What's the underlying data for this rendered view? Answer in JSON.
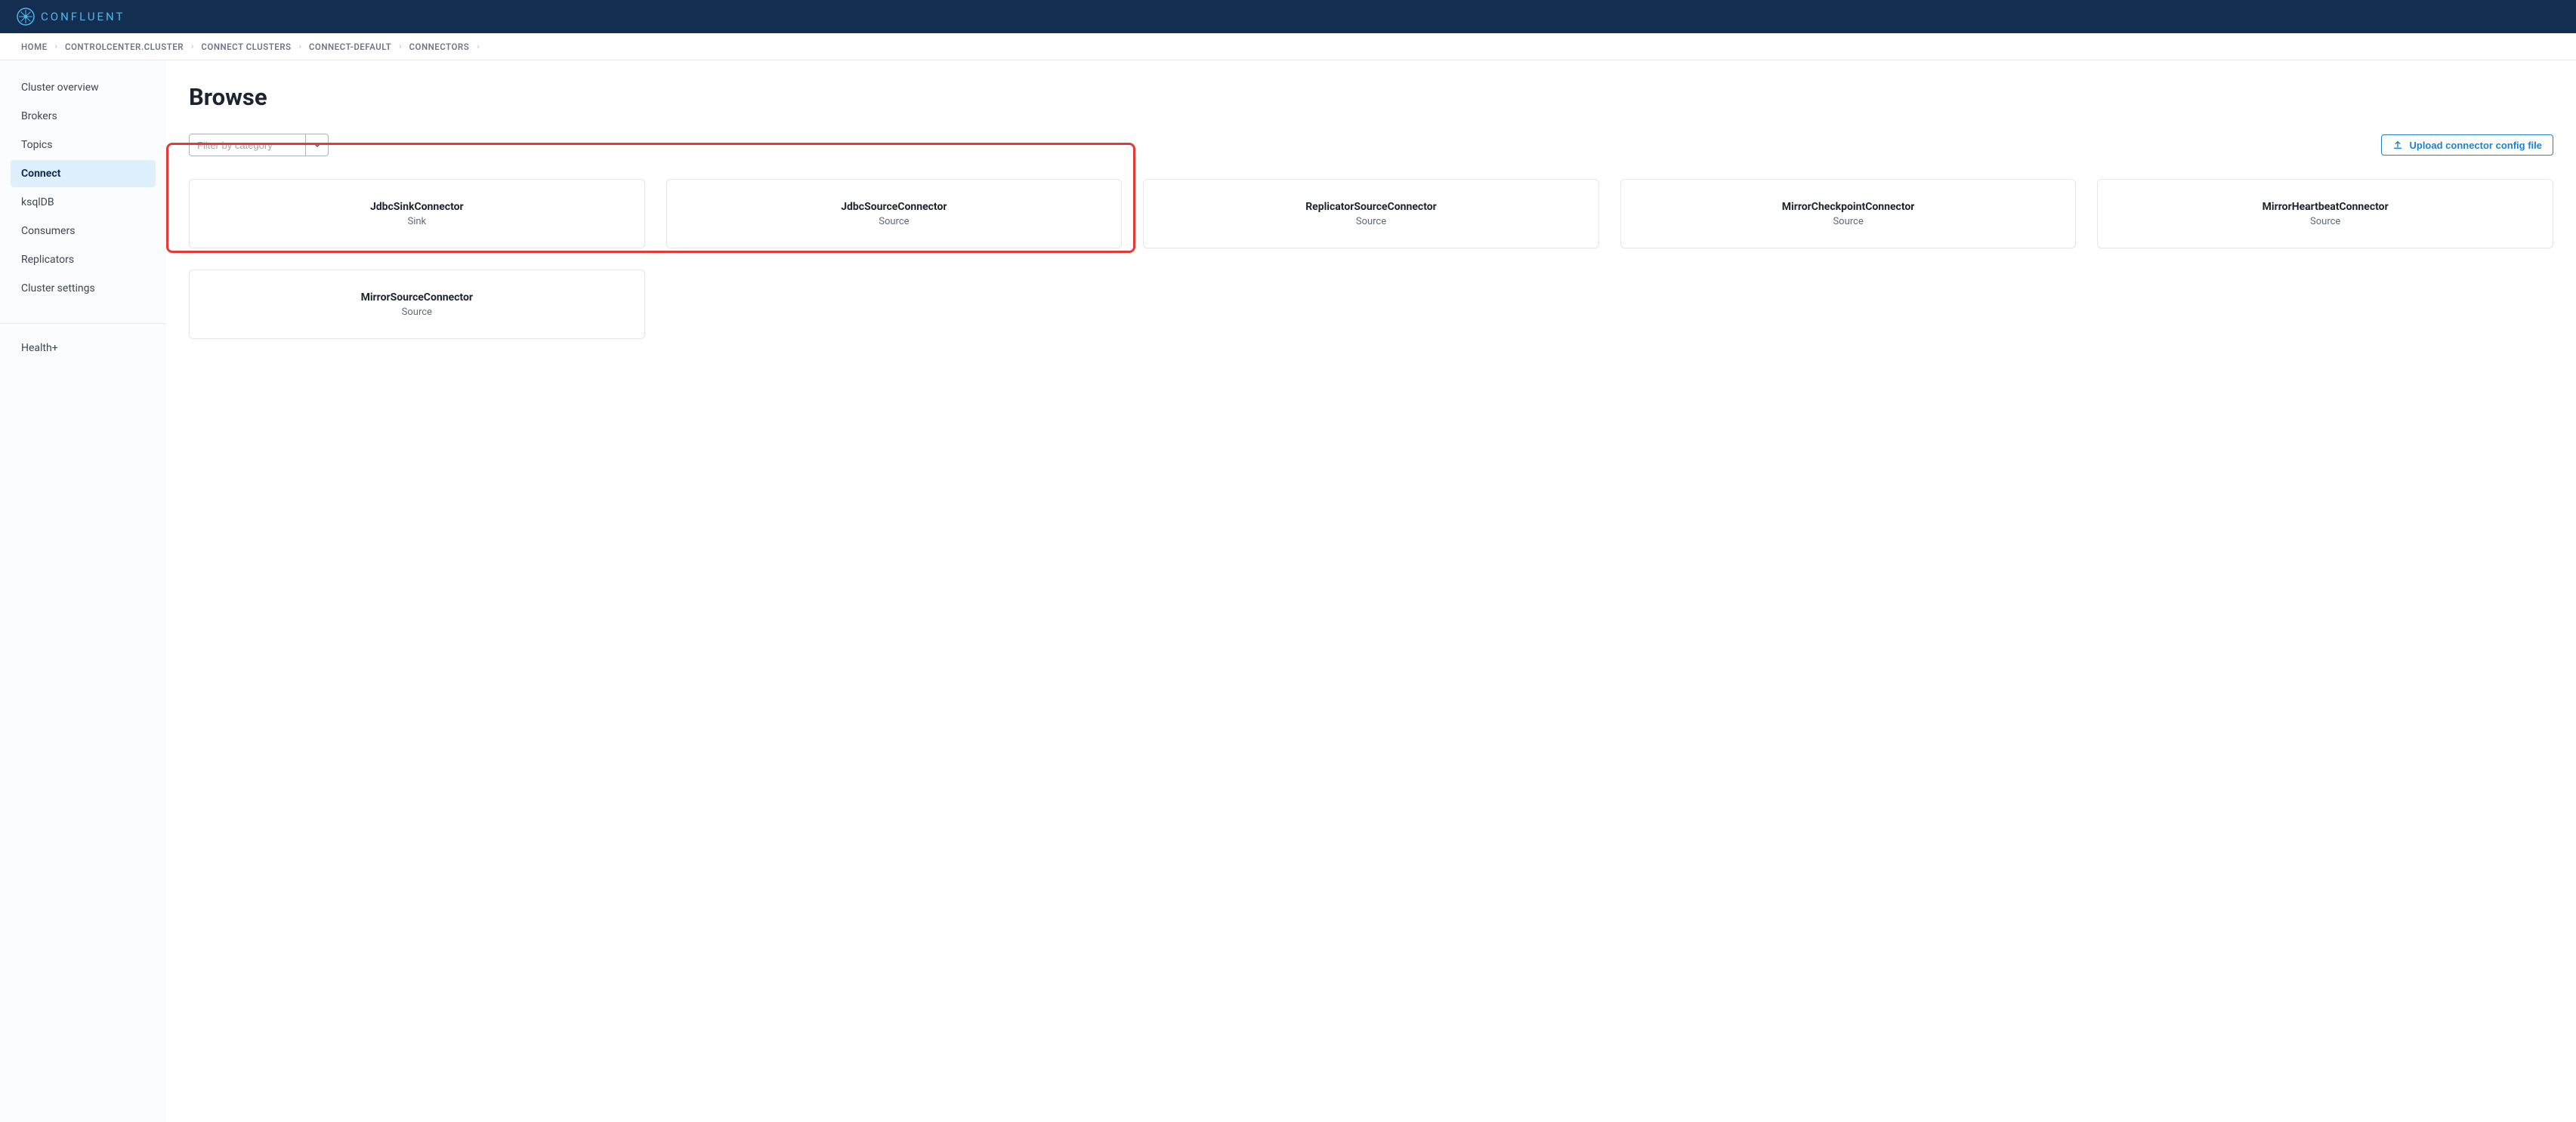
{
  "brand": "CONFLUENT",
  "breadcrumbs": [
    {
      "label": "HOME"
    },
    {
      "label": "CONTROLCENTER.CLUSTER"
    },
    {
      "label": "CONNECT CLUSTERS"
    },
    {
      "label": "CONNECT-DEFAULT"
    },
    {
      "label": "CONNECTORS"
    }
  ],
  "sidebar": {
    "items": [
      {
        "label": "Cluster overview",
        "active": false
      },
      {
        "label": "Brokers",
        "active": false
      },
      {
        "label": "Topics",
        "active": false
      },
      {
        "label": "Connect",
        "active": true
      },
      {
        "label": "ksqlDB",
        "active": false
      },
      {
        "label": "Consumers",
        "active": false
      },
      {
        "label": "Replicators",
        "active": false
      },
      {
        "label": "Cluster settings",
        "active": false
      }
    ],
    "footer_label": "Health+"
  },
  "page": {
    "title": "Browse",
    "filter_placeholder": "Filter by category",
    "upload_button": "Upload connector config file"
  },
  "connectors": [
    {
      "name": "JdbcSinkConnector",
      "type": "Sink"
    },
    {
      "name": "JdbcSourceConnector",
      "type": "Source"
    },
    {
      "name": "ReplicatorSourceConnector",
      "type": "Source"
    },
    {
      "name": "MirrorCheckpointConnector",
      "type": "Source"
    },
    {
      "name": "MirrorHeartbeatConnector",
      "type": "Source"
    },
    {
      "name": "MirrorSourceConnector",
      "type": "Source"
    }
  ],
  "highlight": {
    "connector_indices": [
      0,
      1
    ]
  }
}
